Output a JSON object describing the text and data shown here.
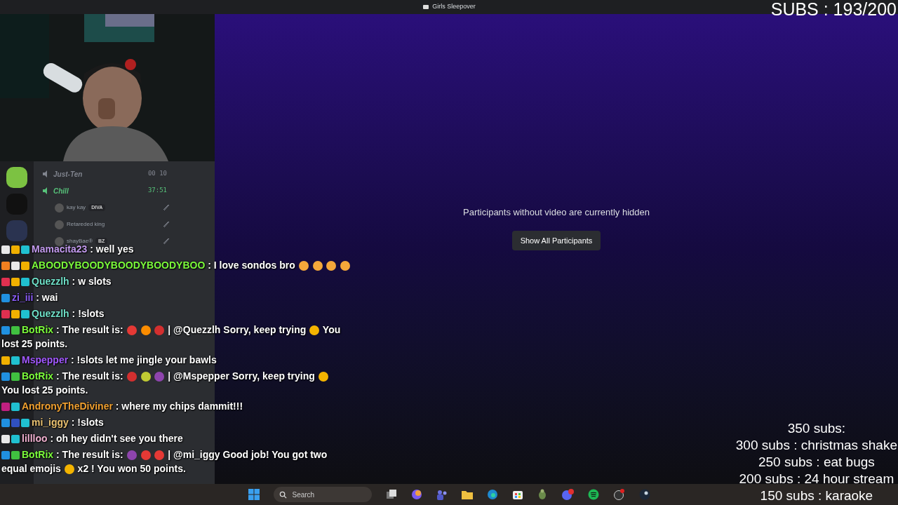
{
  "window": {
    "title": "Girls Sleepover"
  },
  "stage": {
    "message": "Participants without video are currently hidden",
    "button": "Show All Participants"
  },
  "servers": [
    {
      "color": "#7cc242"
    },
    {
      "color": "#111111"
    },
    {
      "color": "#2a3350"
    }
  ],
  "channels": [
    {
      "name": "Just-Ten",
      "active": false,
      "meta": "00 10"
    },
    {
      "name": "Chill",
      "active": true,
      "meta": "37:51",
      "members": [
        {
          "name": "kay kay",
          "tag": "DIVA"
        },
        {
          "name": "Retareded king"
        },
        {
          "name": "shayBae®",
          "tag": "BZ"
        }
      ]
    }
  ],
  "sub_counter": "SUBS : 193/200",
  "chat": [
    {
      "user": "Mamacita23",
      "color": "#c39bef",
      "badges": [
        {
          "color": "#e8e8e8"
        },
        {
          "color": "#f0b000"
        },
        {
          "color": "#20c0d0"
        }
      ],
      "separator": ":",
      "message": [
        {
          "kind": "text",
          "text": "well yes"
        }
      ]
    },
    {
      "user": "ABOODYBOODYBOODYBOODYBOO",
      "color": "#7cfc3c",
      "badges": [
        {
          "color": "#f08020"
        },
        {
          "color": "#e8e8e8"
        },
        {
          "color": "#f0b000"
        }
      ],
      "separator": ":",
      "message": [
        {
          "kind": "text",
          "text": "I love sondos bro"
        },
        {
          "kind": "emoji",
          "color": "#f4a83a"
        },
        {
          "kind": "emoji",
          "color": "#f4a83a"
        },
        {
          "kind": "emoji",
          "color": "#f4a83a"
        },
        {
          "kind": "emoji",
          "color": "#f4a83a"
        }
      ]
    },
    {
      "user": "Quezzlh",
      "color": "#6fe0c8",
      "badges": [
        {
          "color": "#e03050"
        },
        {
          "color": "#f0b000"
        },
        {
          "color": "#20c0d0"
        }
      ],
      "separator": ":",
      "message": [
        {
          "kind": "text",
          "text": "w slots"
        }
      ]
    },
    {
      "user": "zi_iii",
      "color": "#8a5cf6",
      "badges": [
        {
          "color": "#2090e0"
        }
      ],
      "separator": ":",
      "message": [
        {
          "kind": "text",
          "text": "wai"
        }
      ]
    },
    {
      "user": "Quezzlh",
      "color": "#6fe0c8",
      "badges": [
        {
          "color": "#e03050"
        },
        {
          "color": "#f0b000"
        },
        {
          "color": "#20c0d0"
        }
      ],
      "separator": ":",
      "message": [
        {
          "kind": "text",
          "text": "!slots"
        }
      ]
    },
    {
      "user": "BotRix",
      "color": "#7cfc3c",
      "badges": [
        {
          "color": "#2090e0"
        },
        {
          "color": "#40c040"
        }
      ],
      "separator": ":",
      "message": [
        {
          "kind": "text",
          "text": "The result is:"
        },
        {
          "kind": "emoji",
          "color": "#e53935"
        },
        {
          "kind": "emoji",
          "color": "#fb8c00"
        },
        {
          "kind": "emoji",
          "color": "#d32f2f"
        },
        {
          "kind": "text",
          "text": "| @Quezzlh Sorry, keep trying"
        },
        {
          "kind": "emoji",
          "color": "#f4b400"
        },
        {
          "kind": "text",
          "text": "You"
        },
        {
          "kind": "text",
          "text": "lost 25 points."
        }
      ]
    },
    {
      "user": "Mspepper",
      "color": "#a259ff",
      "badges": [
        {
          "color": "#f0b000"
        },
        {
          "color": "#20c0d0"
        }
      ],
      "separator": ":",
      "message": [
        {
          "kind": "text",
          "text": "!slots let me jingle your bawls"
        }
      ]
    },
    {
      "user": "BotRix",
      "color": "#7cfc3c",
      "badges": [
        {
          "color": "#2090e0"
        },
        {
          "color": "#40c040"
        }
      ],
      "separator": ":",
      "message": [
        {
          "kind": "text",
          "text": "The result is:"
        },
        {
          "kind": "emoji",
          "color": "#d32f2f"
        },
        {
          "kind": "emoji",
          "color": "#c0ca33"
        },
        {
          "kind": "emoji",
          "color": "#8e44ad"
        },
        {
          "kind": "text",
          "text": "| @Mspepper Sorry, keep trying"
        },
        {
          "kind": "emoji",
          "color": "#f4b400"
        },
        {
          "kind": "text",
          "text": "You lost 25 points."
        }
      ]
    },
    {
      "user": "AndronyTheDiviner",
      "color": "#f0a030",
      "badges": [
        {
          "color": "#c02080"
        },
        {
          "color": "#20c0d0"
        }
      ],
      "separator": ":",
      "message": [
        {
          "kind": "text",
          "text": "where my chips dammit!!!"
        }
      ]
    },
    {
      "user": "mi_iggy",
      "color": "#e8c070",
      "badges": [
        {
          "color": "#2090e0"
        },
        {
          "color": "#3050c0"
        },
        {
          "color": "#20c0d0"
        }
      ],
      "separator": ":",
      "message": [
        {
          "kind": "text",
          "text": "!slots"
        }
      ]
    },
    {
      "user": "lillloo",
      "color": "#f0b0d0",
      "badges": [
        {
          "color": "#e8e8e8"
        },
        {
          "color": "#20c0d0"
        }
      ],
      "separator": ":",
      "message": [
        {
          "kind": "text",
          "text": "oh hey didn't see you there"
        }
      ]
    },
    {
      "user": "BotRix",
      "color": "#7cfc3c",
      "badges": [
        {
          "color": "#2090e0"
        },
        {
          "color": "#40c040"
        }
      ],
      "separator": ":",
      "message": [
        {
          "kind": "text",
          "text": "The result is:"
        },
        {
          "kind": "emoji",
          "color": "#8e44ad"
        },
        {
          "kind": "emoji",
          "color": "#e53935"
        },
        {
          "kind": "emoji",
          "color": "#e53935"
        },
        {
          "kind": "text",
          "text": "| @mi_iggy Good job! You got two"
        },
        {
          "kind": "text",
          "text": "equal emojis"
        },
        {
          "kind": "emoji",
          "color": "#f4b400"
        },
        {
          "kind": "text",
          "text": "x2 ! You won 50 points."
        }
      ]
    }
  ],
  "goals": [
    "350 subs:",
    "300 subs : christmas shake",
    "250 subs : eat bugs",
    "200 subs : 24 hour stream",
    "150 subs : karaoke"
  ],
  "taskbar": {
    "search": "Search"
  }
}
